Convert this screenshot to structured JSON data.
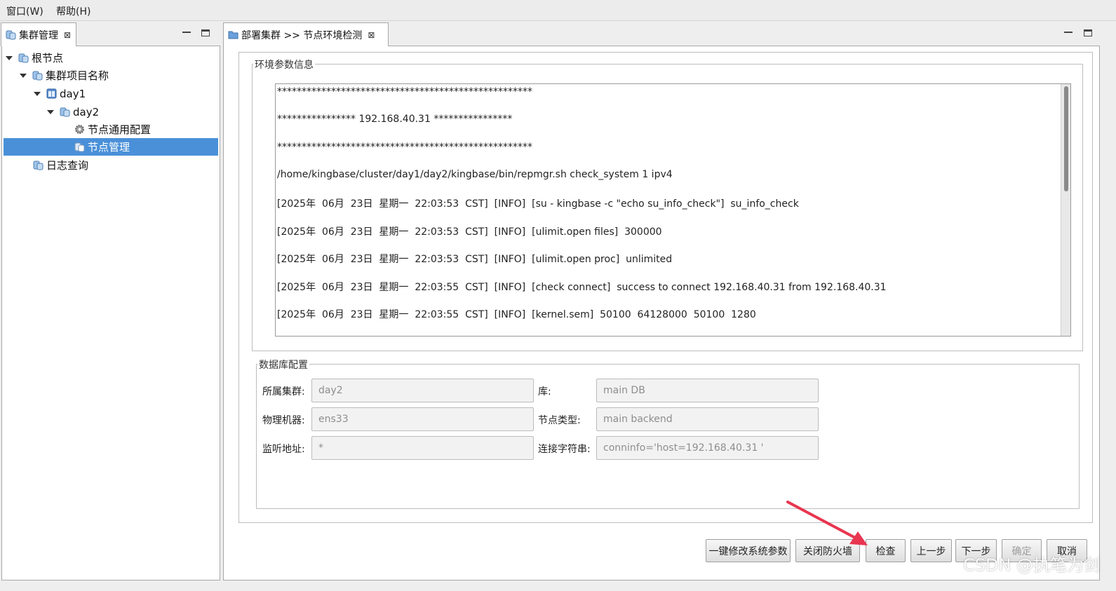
{
  "menubar": {
    "items": [
      "窗口(W)",
      "帮助(H)"
    ]
  },
  "left_panel": {
    "tab_label": "集群管理",
    "tree": [
      {
        "label": "根节点"
      },
      {
        "label": "集群项目名称"
      },
      {
        "label": "day1"
      },
      {
        "label": "day2"
      },
      {
        "label": "节点通用配置"
      },
      {
        "label": "节点管理"
      },
      {
        "label": "日志查询"
      }
    ]
  },
  "main_panel": {
    "tab_label": "部署集群 >> 节点环境检测",
    "env_group_title": "环境参数信息",
    "log_lines": [
      "****************************************************",
      "**************** 192.168.40.31 ****************",
      "****************************************************",
      "/home/kingbase/cluster/day1/day2/kingbase/bin/repmgr.sh check_system 1 ipv4",
      "[2025年  06月  23日  星期一  22:03:53  CST]  [INFO]  [su - kingbase -c \"echo su_info_check\"]  su_info_check",
      "[2025年  06月  23日  星期一  22:03:53  CST]  [INFO]  [ulimit.open files]  300000",
      "[2025年  06月  23日  星期一  22:03:53  CST]  [INFO]  [ulimit.open proc]  unlimited",
      "[2025年  06月  23日  星期一  22:03:55  CST]  [INFO]  [check connect]  success to connect 192.168.40.31 from 192.168.40.31",
      "[2025年  06月  23日  星期一  22:03:55  CST]  [INFO]  [kernel.sem]  50100  64128000  50100  1280"
    ],
    "db_group_title": "数据库配置",
    "db_form": {
      "cluster_label": "所属集群:",
      "cluster_value": "day2",
      "db_label": "库:",
      "db_value": "main DB",
      "machine_label": "物理机器:",
      "machine_value": "ens33",
      "node_type_label": "节点类型:",
      "node_type_value": "main backend",
      "listen_label": "监听地址:",
      "listen_value": "*",
      "conn_label": "连接字符串:",
      "conn_value": "conninfo='host=192.168.40.31 '"
    },
    "buttons": {
      "modify_params": "一键修改系统参数",
      "close_firewall": "关闭防火墙",
      "check": "检查",
      "prev": "上一步",
      "next": "下一步",
      "confirm": "确定",
      "cancel": "取消"
    }
  },
  "watermark": "CSDN @执笔为剑",
  "colors": {
    "selection": "#4a90d9",
    "annotation_arrow": "#e8364f"
  }
}
